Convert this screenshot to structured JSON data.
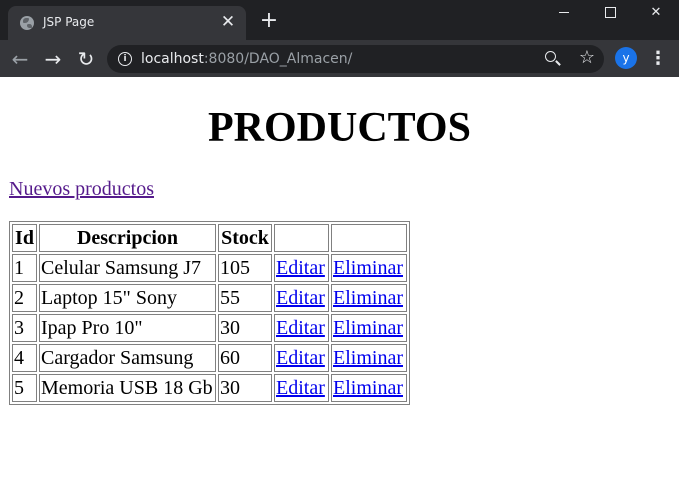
{
  "browser": {
    "tab_title": "JSP Page",
    "new_tab": "+",
    "url_host": "localhost",
    "url_rest": ":8080/DAO_Almacen/",
    "profile_initial": "y"
  },
  "page": {
    "title": "PRODUCTOS",
    "new_products_link": "Nuevos productos",
    "table": {
      "headers": [
        "Id",
        "Descripcion",
        "Stock",
        "",
        ""
      ],
      "rows": [
        {
          "id": "1",
          "descripcion": "Celular Samsung J7",
          "stock": "105",
          "edit": "Editar",
          "delete": "Eliminar"
        },
        {
          "id": "2",
          "descripcion": "Laptop 15\" Sony",
          "stock": "55",
          "edit": "Editar",
          "delete": "Eliminar"
        },
        {
          "id": "3",
          "descripcion": "Ipap Pro 10\"",
          "stock": "30",
          "edit": "Editar",
          "delete": "Eliminar"
        },
        {
          "id": "4",
          "descripcion": "Cargador Samsung",
          "stock": "60",
          "edit": "Editar",
          "delete": "Eliminar"
        },
        {
          "id": "5",
          "descripcion": "Memoria USB 18 Gb",
          "stock": "30",
          "edit": "Editar",
          "delete": "Eliminar"
        }
      ]
    }
  }
}
